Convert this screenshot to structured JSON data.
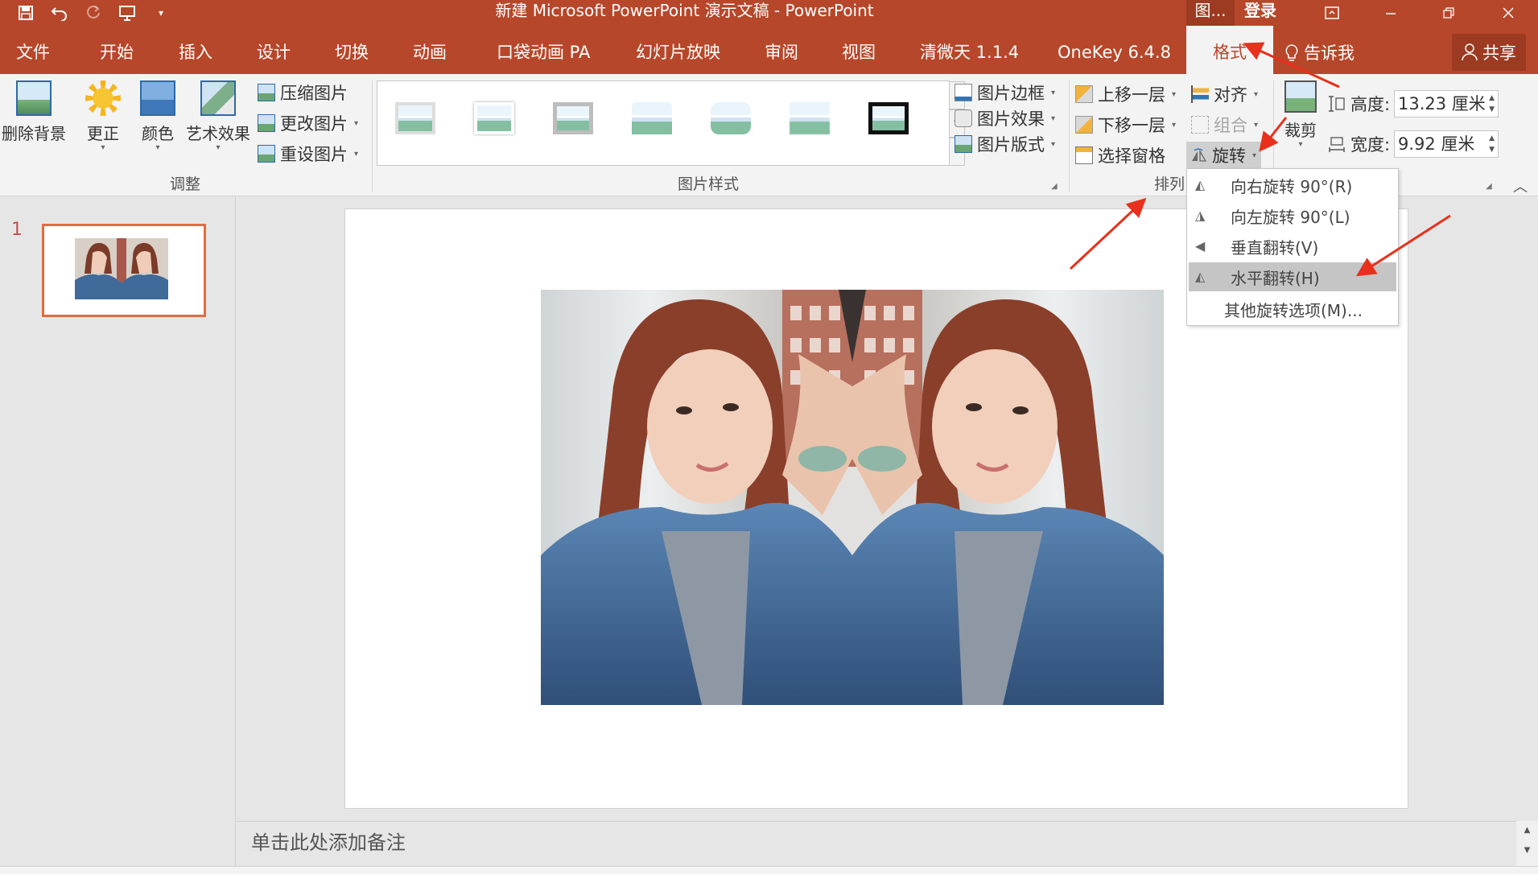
{
  "titlebar": {
    "title": "新建 Microsoft PowerPoint 演示文稿  -  PowerPoint",
    "context_tab": "图...",
    "login": "登录",
    "qat": {
      "save": "save-icon",
      "undo": "undo-icon",
      "redo": "redo-icon",
      "present": "present-icon",
      "customize": "customize-icon"
    }
  },
  "tabs": [
    {
      "label": "文件"
    },
    {
      "label": "开始"
    },
    {
      "label": "插入"
    },
    {
      "label": "设计"
    },
    {
      "label": "切换"
    },
    {
      "label": "动画"
    },
    {
      "label": "口袋动画 PA"
    },
    {
      "label": "幻灯片放映"
    },
    {
      "label": "审阅"
    },
    {
      "label": "视图"
    },
    {
      "label": "清微天 1.1.4"
    },
    {
      "label": "OneKey 6.4.8"
    },
    {
      "label": "格式",
      "active": true
    }
  ],
  "tell_me": "告诉我",
  "share": "共享",
  "ribbon": {
    "adjust": {
      "label": "调整",
      "remove_bg": "删除背景",
      "corrections": "更正",
      "color": "颜色",
      "artistic": "艺术效果",
      "compress": "压缩图片",
      "change": "更改图片",
      "reset": "重设图片"
    },
    "styles": {
      "label": "图片样式",
      "border": "图片边框",
      "effects": "图片效果",
      "layout": "图片版式"
    },
    "arrange": {
      "label": "排列",
      "bring_forward": "上移一层",
      "send_backward": "下移一层",
      "selection_pane": "选择窗格",
      "align": "对齐",
      "group": "组合",
      "rotate": "旋转"
    },
    "size": {
      "crop": "裁剪",
      "height_label": "高度:",
      "height_value": "13.23 厘米",
      "width_label": "宽度:",
      "width_value": "9.92 厘米"
    }
  },
  "rotate_menu": [
    {
      "label": "向右旋转 90°(R)"
    },
    {
      "label": "向左旋转 90°(L)"
    },
    {
      "label": "垂直翻转(V)"
    },
    {
      "label": "水平翻转(H)",
      "highlighted": true
    },
    {
      "label": "其他旋转选项(M)..."
    }
  ],
  "slides": [
    {
      "number": "1"
    }
  ],
  "notes_placeholder": "单击此处添加备注",
  "colors": {
    "accent": "#b7472a",
    "annotation_arrow": "#e8301c"
  }
}
